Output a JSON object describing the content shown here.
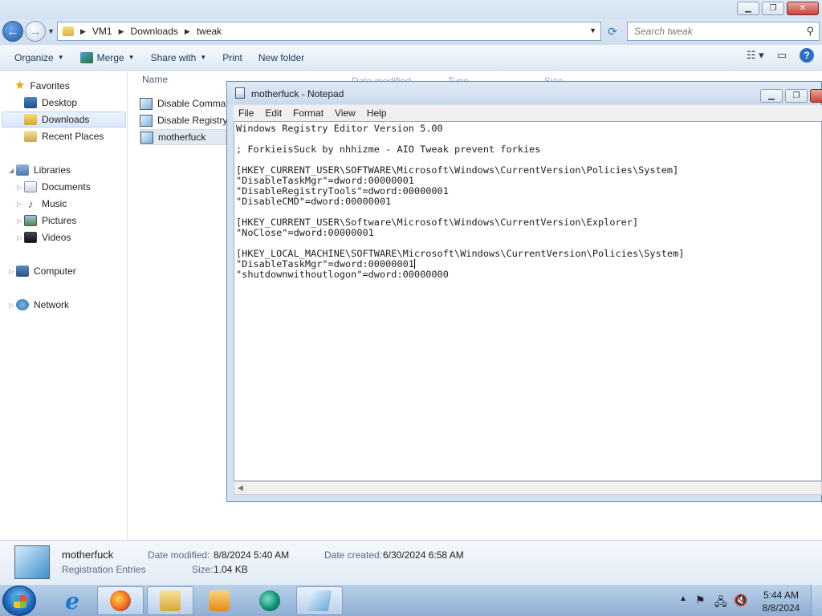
{
  "explorer": {
    "window_buttons": {
      "minimize": "▁",
      "restore": "❐",
      "close": "✕"
    },
    "address": {
      "crumbs": [
        "VM1",
        "Downloads",
        "tweak"
      ]
    },
    "search": {
      "placeholder": "Search tweak"
    },
    "toolbar": {
      "organize": "Organize",
      "merge": "Merge",
      "share_with": "Share with",
      "print": "Print",
      "new_folder": "New folder"
    },
    "nav": {
      "favorites": "Favorites",
      "desktop": "Desktop",
      "downloads": "Downloads",
      "recent_places": "Recent Places",
      "libraries": "Libraries",
      "documents": "Documents",
      "music": "Music",
      "pictures": "Pictures",
      "videos": "Videos",
      "computer": "Computer",
      "network": "Network"
    },
    "columns": {
      "name": "Name",
      "date_modified": "Date modified",
      "type": "Type",
      "size": "Size"
    },
    "files": [
      {
        "name": "Disable Command Prompt"
      },
      {
        "name": "Disable Registry Editor"
      },
      {
        "name": "motherfuck"
      }
    ],
    "details": {
      "name": "motherfuck",
      "type": "Registration Entries",
      "date_modified_label": "Date modified:",
      "date_modified": "8/8/2024 5:40 AM",
      "date_created_label": "Date created:",
      "date_created": "6/30/2024 6:58 AM",
      "size_label": "Size:",
      "size": "1.04 KB"
    }
  },
  "notepad": {
    "title": "motherfuck - Notepad",
    "menu": [
      "File",
      "Edit",
      "Format",
      "View",
      "Help"
    ],
    "lines": [
      "Windows Registry Editor Version 5.00",
      "",
      "; ForkieisSuck by nhhizme - AIO Tweak prevent forkies",
      "",
      "[HKEY_CURRENT_USER\\SOFTWARE\\Microsoft\\Windows\\CurrentVersion\\Policies\\System]",
      "\"DisableTaskMgr\"=dword:00000001",
      "\"DisableRegistryTools\"=dword:00000001",
      "\"DisableCMD\"=dword:00000001",
      "",
      "[HKEY_CURRENT_USER\\Software\\Microsoft\\Windows\\CurrentVersion\\Explorer]",
      "\"NoClose\"=dword:00000001",
      "",
      "[HKEY_LOCAL_MACHINE\\SOFTWARE\\Microsoft\\Windows\\CurrentVersion\\Policies\\System]",
      "\"DisableTaskMgr\"=dword:00000001",
      "\"shutdownwithoutlogon\"=dword:00000000"
    ]
  },
  "taskbar": {
    "apps": [
      "internet-explorer-icon",
      "firefox-icon",
      "windows-explorer-icon",
      "media-player-icon",
      "vm-app-icon",
      "notepad-icon"
    ],
    "time": "5:44 AM",
    "date": "8/8/2024"
  }
}
